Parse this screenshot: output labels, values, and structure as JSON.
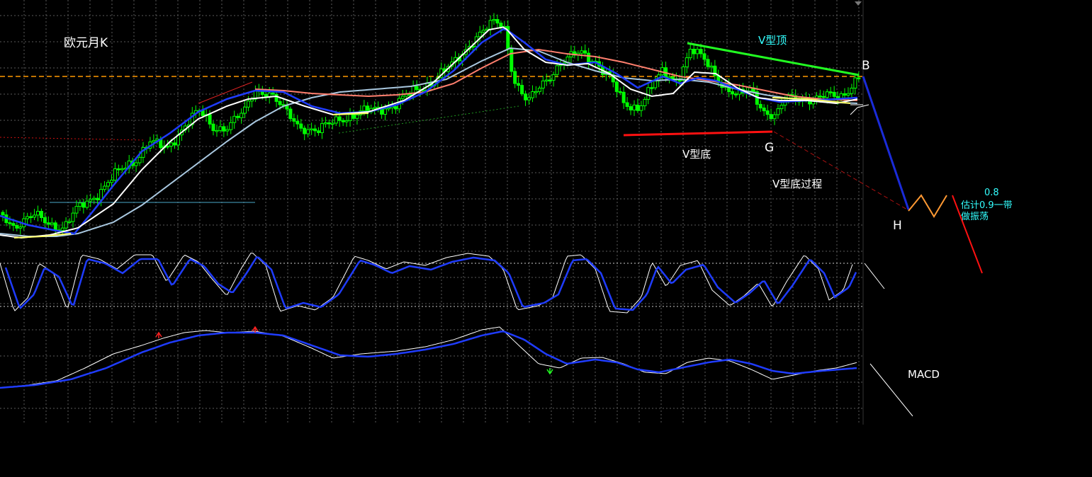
{
  "colors": {
    "background": "#000000",
    "grid": "#5a5a5a",
    "candle_up": "#00ff00",
    "candle_down": "#00ff00",
    "ma_short": "#ffffff",
    "ma_mid": "#a9c8e0",
    "ma_long_up": "#ff7f6e",
    "ma_long_down": "#1f3cff",
    "ma_yellow": "#ffff66",
    "hline_orange": "#ff9900",
    "annot_green": "#22ff22",
    "annot_red": "#ff1111",
    "annot_blue": "#1a2bd8",
    "annot_orange": "#ff9933",
    "text_white": "#ffffff",
    "text_cyan": "#33ffff"
  },
  "chart_data": {
    "type": "candlestick",
    "title": "欧元月K",
    "grid": true,
    "annotations": {
      "v_top": "V型顶",
      "v_bottom": "V型底",
      "v_bottom_process": "V型底过程",
      "point_b": "B",
      "point_g": "G",
      "point_h": "H",
      "level_08": "0.8",
      "estimate_line1": "估计0.9一带",
      "estimate_line2": "做振荡",
      "macd_label": "MACD"
    },
    "indicator_panes": [
      "stochastic",
      "macd"
    ]
  }
}
